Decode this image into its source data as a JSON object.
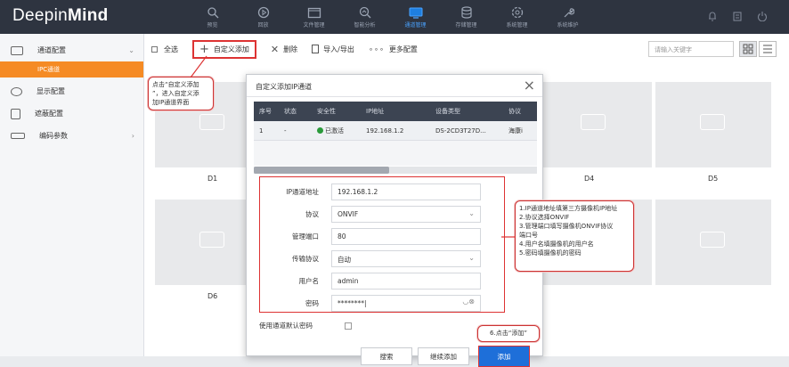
{
  "app": {
    "logo_light": "Deepin",
    "logo_bold": "Mind"
  },
  "nav": [
    {
      "label": "预览",
      "icon": "preview-icon"
    },
    {
      "label": "回放",
      "icon": "playback-icon"
    },
    {
      "label": "文件管理",
      "icon": "folder-icon"
    },
    {
      "label": "智能分析",
      "icon": "analysis-icon"
    },
    {
      "label": "通道管理",
      "icon": "channel-icon",
      "active": true
    },
    {
      "label": "存储管理",
      "icon": "storage-icon"
    },
    {
      "label": "系统管理",
      "icon": "gear-icon"
    },
    {
      "label": "系统维护",
      "icon": "wrench-icon"
    }
  ],
  "sidebar": {
    "items": [
      {
        "label": "通道配置"
      },
      {
        "label": "IPC通道",
        "active": true
      },
      {
        "label": "显示配置"
      },
      {
        "label": "遮蔽配置"
      },
      {
        "label": "编码参数"
      }
    ]
  },
  "toolbar": {
    "select_all": "全选",
    "custom_add": "自定义添加",
    "delete": "删除",
    "import_export": "导入/导出",
    "more": "更多配置",
    "search_placeholder": "请输入关键字"
  },
  "tiles": {
    "labels": [
      "D1",
      "D4",
      "D5",
      "D6"
    ]
  },
  "callouts": {
    "c1": [
      "点击“自定义添加",
      "”，进入自定义添",
      "加IP通道界面"
    ],
    "c2": [
      "1.IP通道地址填第三方摄像机IP地址",
      "2.协议选择ONVIF",
      "3.管理端口填写摄像机ONVIF协议",
      "端口号",
      "4.用户名填摄像机的用户名",
      "5.密码填摄像机的密码"
    ],
    "c3": "6.点击“添加”"
  },
  "dialog": {
    "title": "自定义添加IP通道",
    "headers": [
      "序号",
      "状态",
      "安全性",
      "IP地址",
      "设备类型",
      "协议"
    ],
    "row": [
      "1",
      "-",
      "已激活",
      "192.168.1.2",
      "DS-2CD3T27D...",
      "海康i"
    ],
    "fields": {
      "ip": {
        "label": "IP通道地址",
        "value": "192.168.1.2"
      },
      "protocol": {
        "label": "协议",
        "value": "ONVIF"
      },
      "port": {
        "label": "管理端口",
        "value": "80"
      },
      "transport": {
        "label": "传输协议",
        "value": "自动"
      },
      "user": {
        "label": "用户名",
        "value": "admin"
      },
      "password": {
        "label": "密码",
        "value": "********|"
      }
    },
    "default_pw_label": "使用通道默认密码",
    "buttons": {
      "search": "搜索",
      "continue": "继续添加",
      "add": "添加"
    }
  },
  "colors": {
    "accent": "#f58b24",
    "active_nav": "#4aa3ff",
    "callout_border": "#d33"
  }
}
